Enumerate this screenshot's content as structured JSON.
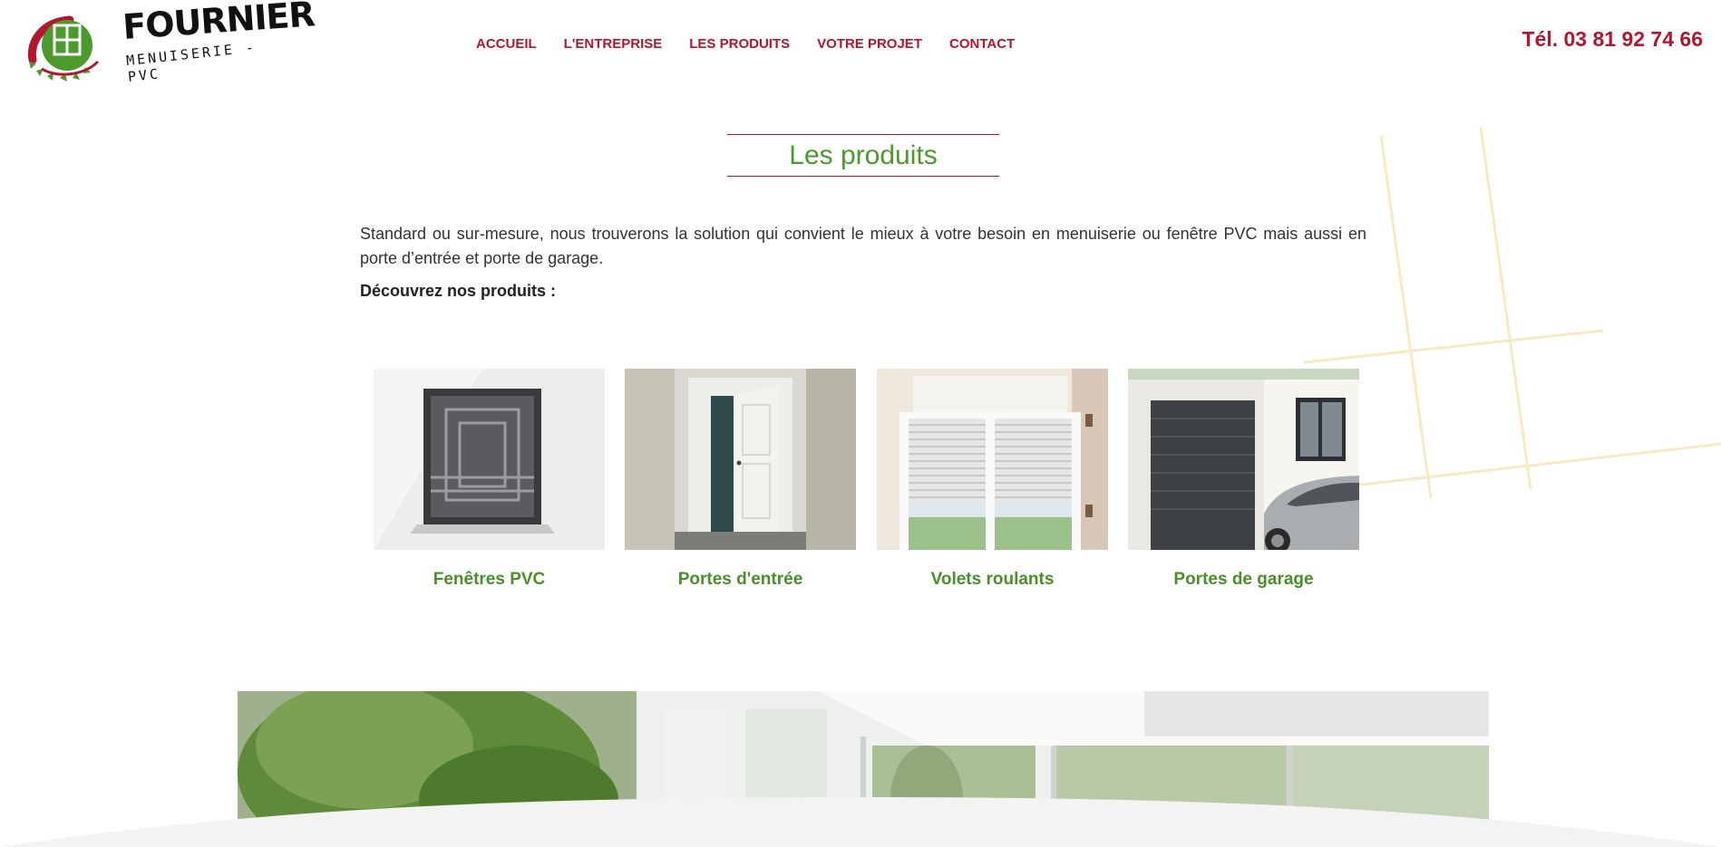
{
  "header": {
    "logo": {
      "wordmark": "FOURNIER",
      "subtitle": "MENUISERIE - PVC",
      "brand_green": "#4a9a2c",
      "brand_red": "#b3162f"
    },
    "nav": [
      {
        "label": "ACCUEIL"
      },
      {
        "label": "L'ENTREPRISE"
      },
      {
        "label": "LES PRODUITS"
      },
      {
        "label": "VOTRE PROJET"
      },
      {
        "label": "CONTACT"
      }
    ],
    "phone": "Tél. 03 81 92 74 66"
  },
  "main": {
    "title": "Les produits",
    "intro": "Standard ou sur-mesure, nous trouverons la solution qui convient le mieux à votre besoin en menuiserie ou fenêtre PVC mais aussi en porte d’entrée et porte de garage.",
    "discover": "Découvrez nos produits :",
    "products": [
      {
        "label": "Fenêtres PVC",
        "icon": "window-photo"
      },
      {
        "label": "Portes d'entrée",
        "icon": "door-photo"
      },
      {
        "label": "Volets roulants",
        "icon": "shutter-photo"
      },
      {
        "label": "Portes de garage",
        "icon": "garage-photo"
      }
    ]
  },
  "colors": {
    "accent_red": "#b3162f",
    "accent_green": "#4a9a2c",
    "deco_yellow": "#f6e7b8"
  }
}
